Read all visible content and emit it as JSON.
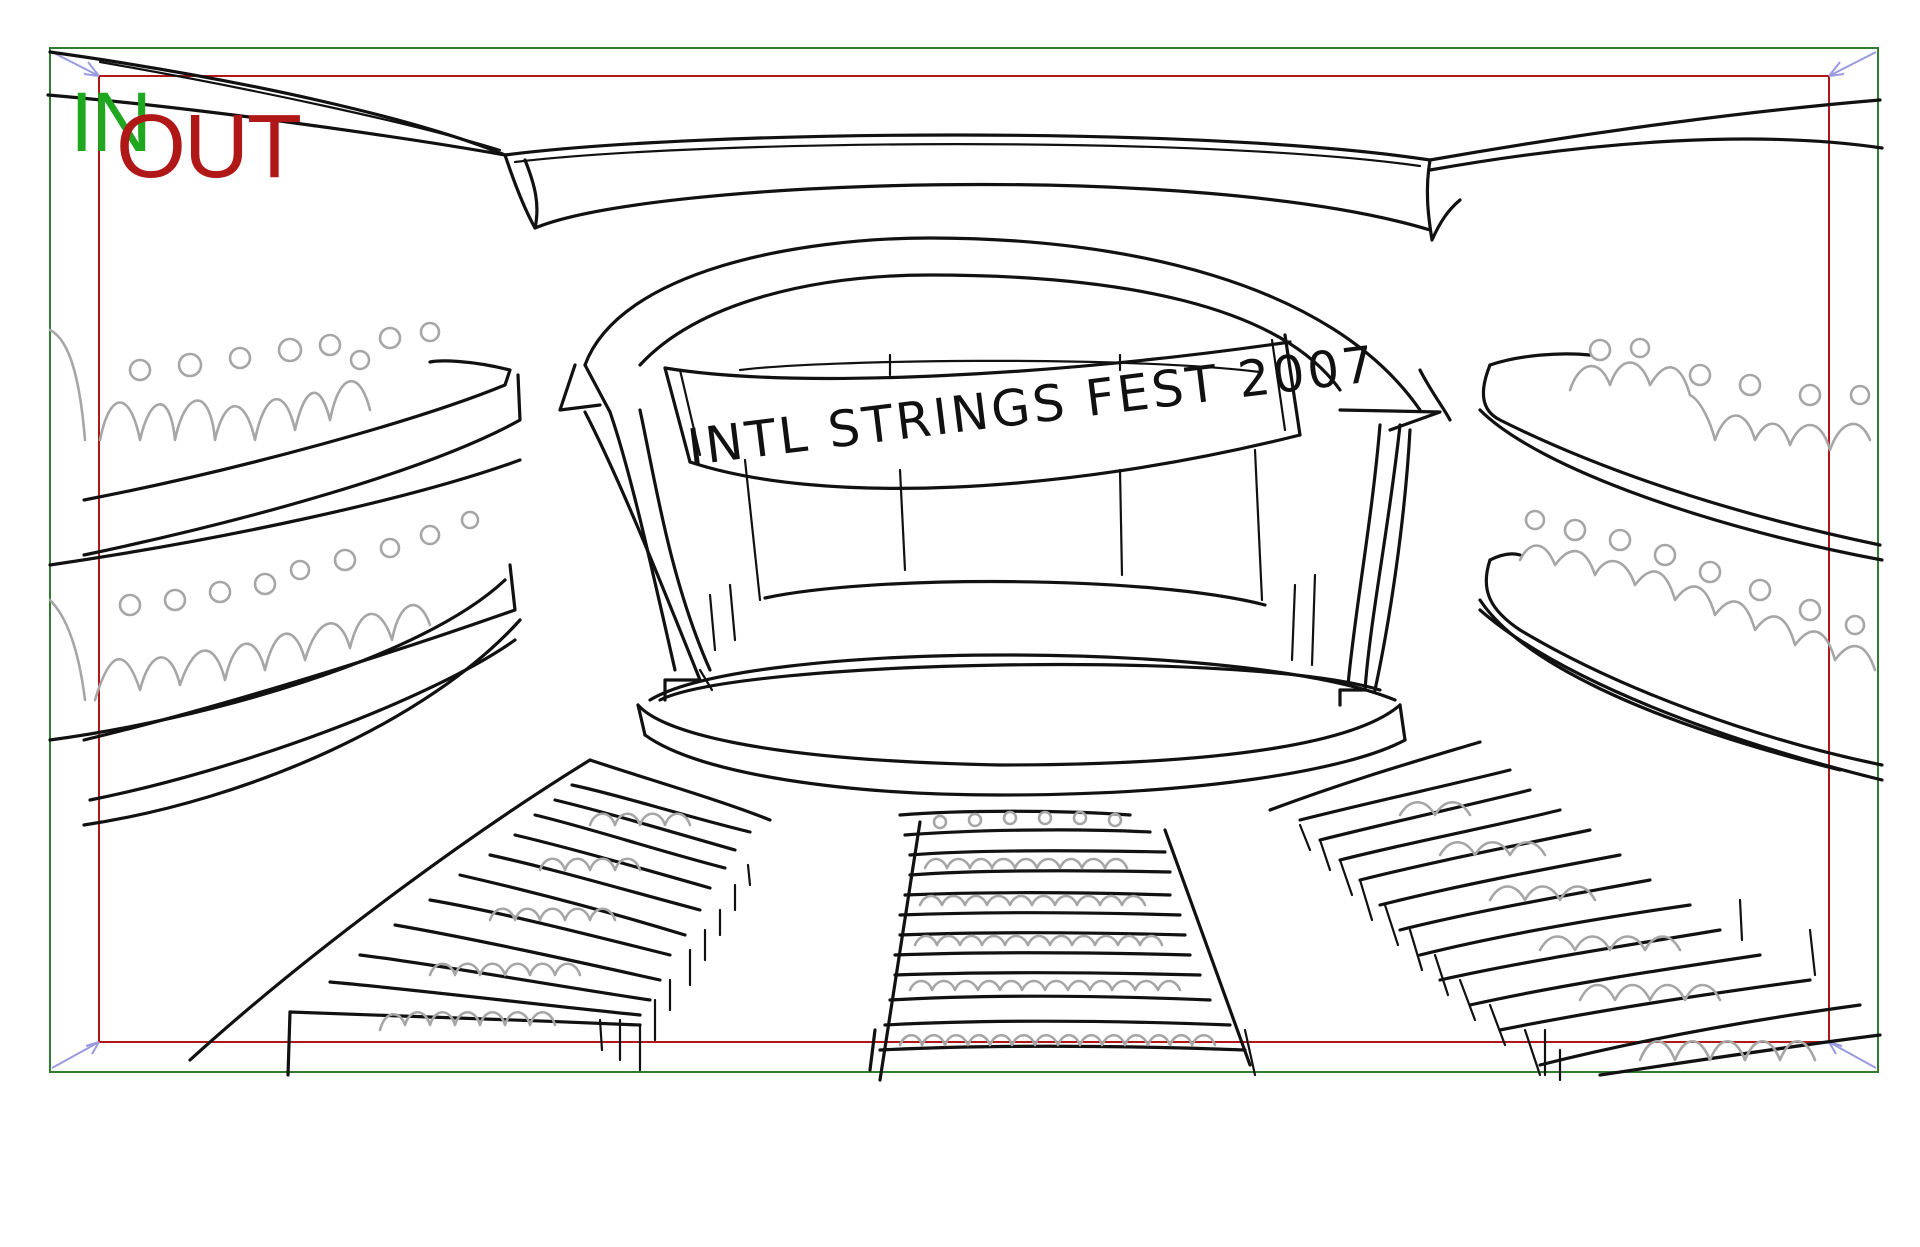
{
  "frame": {
    "in_label": "IN",
    "out_label": "OUT",
    "in_color": "#1fa81f",
    "out_color": "#b01818",
    "corner_marker_color": "#9a9ae0"
  },
  "sketch": {
    "banner_text": "INTL STRINGS FEST 2007",
    "line_color": "#111111",
    "crowd_color": "#a6a6a6"
  }
}
